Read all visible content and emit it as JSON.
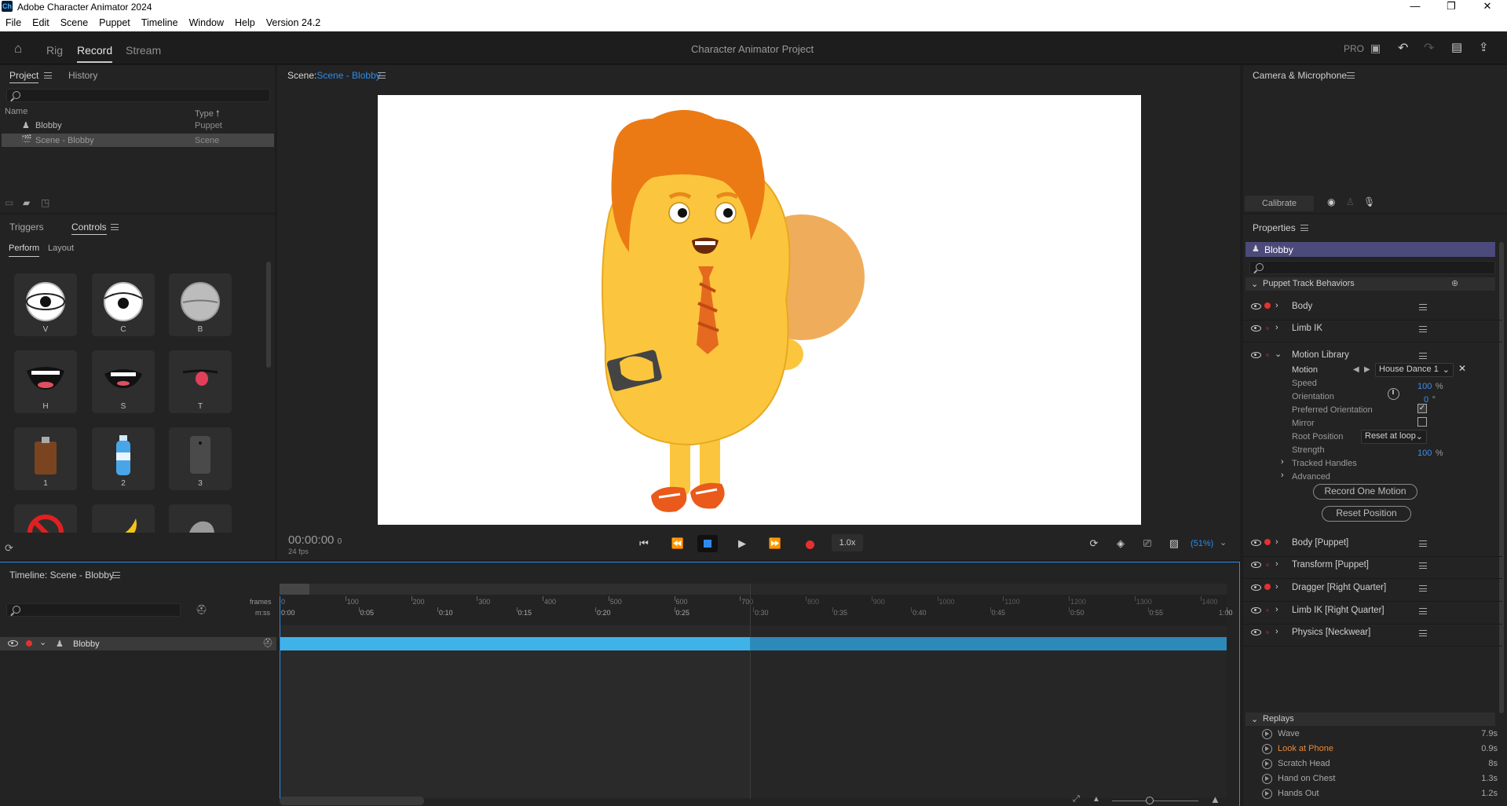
{
  "app": {
    "title": "Adobe Character Animator 2024",
    "icon": "Ch"
  },
  "menu": [
    "File",
    "Edit",
    "Scene",
    "Puppet",
    "Timeline",
    "Window",
    "Help",
    "Version 24.2"
  ],
  "workspaces": {
    "rig": "Rig",
    "record": "Record",
    "stream": "Stream"
  },
  "project_title": "Character Animator Project",
  "pro_badge": "PRO",
  "project_panel": {
    "tabs": [
      "Project",
      "History"
    ],
    "col_name": "Name",
    "col_type": "Type",
    "items": [
      {
        "name": "Blobby",
        "type": "Puppet"
      },
      {
        "name": "Scene - Blobby",
        "type": "Scene"
      }
    ]
  },
  "controls_panel": {
    "tabs": [
      "Triggers",
      "Controls"
    ],
    "subtabs": [
      "Perform",
      "Layout"
    ],
    "tiles": [
      "V",
      "C",
      "B",
      "H",
      "S",
      "T",
      "1",
      "2",
      "3"
    ]
  },
  "scene": {
    "label": "Scene:",
    "name": "Scene - Blobby",
    "timecode": "00:00:00",
    "frame": "0",
    "fps": "24 fps",
    "speed": "1.0x",
    "zoom": "(51%)"
  },
  "camera_panel": {
    "title": "Camera & Microphone",
    "calibrate": "Calibrate"
  },
  "properties": {
    "title": "Properties",
    "puppet": "Blobby",
    "section": "Puppet Track Behaviors",
    "behaviors_top": [
      "Body",
      "Limb IK"
    ],
    "motion_library": {
      "name": "Motion Library",
      "motion_label": "Motion",
      "motion_value": "House Dance 1",
      "speed_label": "Speed",
      "speed_value": "100",
      "speed_unit": "%",
      "orientation_label": "Orientation",
      "orientation_value": "0",
      "orientation_unit": "°",
      "pref_orientation": "Preferred Orientation",
      "mirror": "Mirror",
      "root_label": "Root Position",
      "root_value": "Reset at loop",
      "strength_label": "Strength",
      "strength_value": "100",
      "strength_unit": "%",
      "tracked": "Tracked Handles",
      "advanced": "Advanced",
      "record_btn": "Record One Motion",
      "reset_btn": "Reset Position"
    },
    "behaviors_bottom": [
      "Body [Puppet]",
      "Transform [Puppet]",
      "Dragger [Right Quarter]",
      "Limb IK [Right Quarter]",
      "Physics [Neckwear]"
    ],
    "replays_title": "Replays",
    "replays": [
      {
        "name": "Wave",
        "dur": "7.9s"
      },
      {
        "name": "Look at Phone",
        "dur": "0.9s"
      },
      {
        "name": "Scratch Head",
        "dur": "8s"
      },
      {
        "name": "Hand on Chest",
        "dur": "1.3s"
      },
      {
        "name": "Hands Out",
        "dur": "1.2s"
      }
    ]
  },
  "timeline": {
    "title": "Timeline: Scene - Blobby",
    "frames_label": "frames",
    "mss_label": "m:ss",
    "track": "Blobby",
    "frames": [
      "0",
      "100",
      "200",
      "300",
      "400",
      "500",
      "600",
      "700",
      "800",
      "900",
      "1000",
      "1100",
      "1200",
      "1300",
      "1400"
    ],
    "times": [
      "0:00",
      "0:05",
      "0:10",
      "0:15",
      "0:20",
      "0:25",
      "0:30",
      "0:35",
      "0:40",
      "0:45",
      "0:50",
      "0:55",
      "1:00"
    ]
  },
  "colors": {
    "accent": "#2d8ceb",
    "record": "#e63030",
    "track": "#3fb3e8",
    "replay_active": "#e8883a",
    "puppet_header": "#4b4a7a"
  }
}
